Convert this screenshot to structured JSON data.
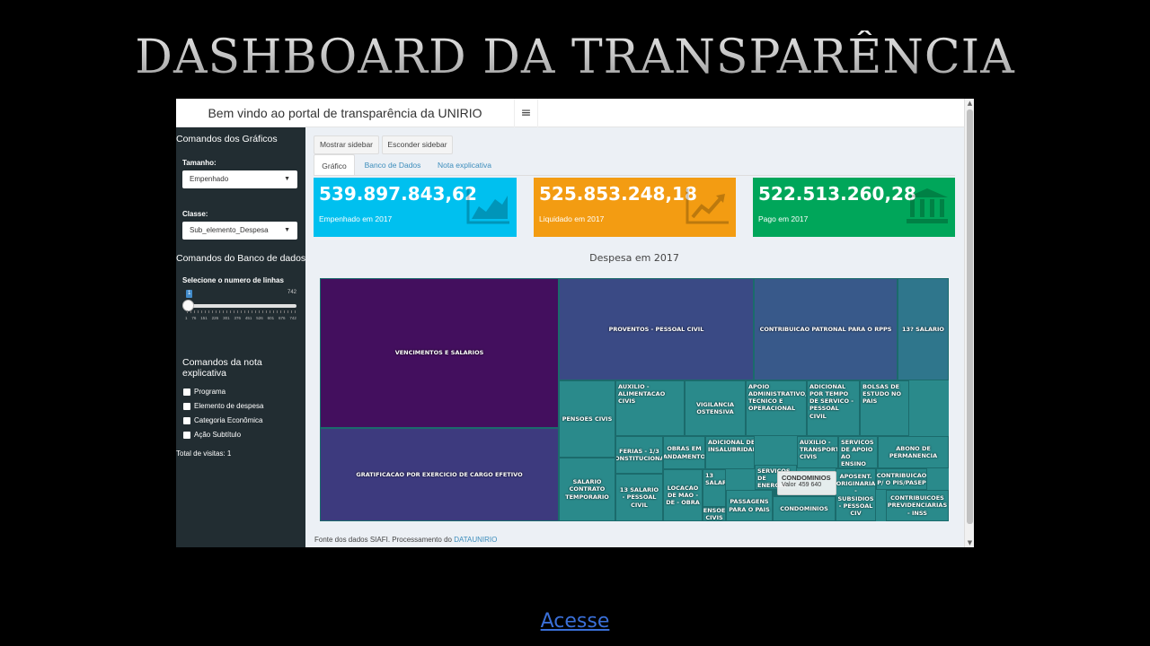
{
  "slide": {
    "title": "Dashboard da Transparência",
    "link_label": "Acesse"
  },
  "header": {
    "brand": "Bem vindo ao portal de transparência da UNIRIO",
    "menu_icon": "≡"
  },
  "sidebar": {
    "section_graphs": "Comandos dos Gráficos",
    "size_label": "Tamanho:",
    "size_value": "Empenhado",
    "class_label": "Classe:",
    "class_value": "Sub_elemento_Despesa",
    "section_db": "Comandos do Banco de dados",
    "rows_label": "Selecione o numero de linhas",
    "slider": {
      "min": "1",
      "max": "742",
      "value": "1",
      "grid": [
        "1",
        "76",
        "151",
        "226",
        "301",
        "376",
        "451",
        "526",
        "601",
        "676",
        "742"
      ]
    },
    "section_note_1": "Comandos da nota",
    "section_note_2": "explicativa",
    "checks": [
      "Programa",
      "Elemento de despesa",
      "Categoria Econômica",
      "Ação Subtítulo"
    ],
    "visits": "Total de visitas: 1"
  },
  "toolbar": {
    "show_sidebar": "Mostrar sidebar",
    "hide_sidebar": "Esconder sidebar"
  },
  "tabs": [
    "Gráfico",
    "Banco de Dados",
    "Nota explicativa"
  ],
  "value_boxes": [
    {
      "value": "539.897.843,62",
      "label": "Empenhado em 2017",
      "color": "#00c0ef",
      "icon": "area-chart-icon"
    },
    {
      "value": "525.853.248,18",
      "label": "Liquidado em 2017",
      "color": "#f39c12",
      "icon": "line-chart-icon"
    },
    {
      "value": "522.513.260,28",
      "label": "Pago em 2017",
      "color": "#00a65a",
      "icon": "bank-icon"
    }
  ],
  "chart_data": {
    "type": "treemap",
    "title": "Despesa em 2017",
    "cells": [
      {
        "name": "VENCIMENTOS E SALARIOS",
        "color": "#430f5e"
      },
      {
        "name": "GRATIFICACAO POR EXERCICIO DE CARGO EFETIVO",
        "color": "#3d3a7e"
      },
      {
        "name": "PROVENTOS - PESSOAL CIVIL",
        "color": "#3a4a85"
      },
      {
        "name": "CONTRIBUICAO PATRONAL PARA O RPPS",
        "color": "#38598a"
      },
      {
        "name": "13? SALARIO",
        "color": "#2f768c"
      },
      {
        "name": "PENSOES CIVIS",
        "color": "#2a8a8b"
      },
      {
        "name": "AUXILIO - ALIMENTACAO CIVIS",
        "color": "#2a8a8b"
      },
      {
        "name": "VIGILANCIA OSTENSIVA",
        "color": "#2a8a8b"
      },
      {
        "name": "APOIO ADMINISTRATIVO, TECNICO E OPERACIONAL",
        "color": "#2a8a8b"
      },
      {
        "name": "ADICIONAL POR TEMPO DE SERVICO - PESSOAL CIVIL",
        "color": "#2a8a8b"
      },
      {
        "name": "BOLSAS DE ESTUDO NO PAIS",
        "color": "#2a8a8b"
      },
      {
        "name": "FERIAS - 1/3 CONSTITUCIONAL",
        "color": "#2a8a8b"
      },
      {
        "name": "OBRAS EM ANDAMENTO",
        "color": "#2a8a8b"
      },
      {
        "name": "ADICIONAL DE INSALUBRIDADE",
        "color": "#2a8a8b"
      },
      {
        "name": "AUXILIO - TRANSPORTE CIVIS",
        "color": "#2a8a8b"
      },
      {
        "name": "SERVICOS DE APOIO AO ENSINO",
        "color": "#2a8a8b"
      },
      {
        "name": "ABONO DE PERMANENCIA",
        "color": "#2a8a8b"
      },
      {
        "name": "SALARIO CONTRATO TEMPORARIO",
        "color": "#2a8a8b"
      },
      {
        "name": "13 SALARIO - PESSOAL CIVIL",
        "color": "#2a8a8b"
      },
      {
        "name": "LOCACAO DE MAO - DE - OBRA",
        "color": "#2a8a8b"
      },
      {
        "name": "13 SALARIO",
        "color": "#2a8a8b"
      },
      {
        "name": "PENSOES CIVIS",
        "color": "#2a8a8b"
      },
      {
        "name": "PASSAGENS PARA O PAIS",
        "color": "#2a8a8b"
      },
      {
        "name": "SERVICOS DE ENERGIA ELETRICA",
        "color": "#2a8a8b"
      },
      {
        "name": "CONDOMINIOS",
        "color": "#2a8a8b"
      },
      {
        "name": "APOSENT. ORIGINARIA - SUBSIDIOS - PESSOAL CIV",
        "color": "#2a8a8b"
      },
      {
        "name": "CONTRIBUICAO P/ O PIS/PASEP",
        "color": "#2a8a8b"
      },
      {
        "name": "CONTRIBUICOES PREVIDENCIARIAS - INSS",
        "color": "#2a8a8b"
      }
    ],
    "tooltip": {
      "name": "CONDOMINIOS",
      "label": "Valor",
      "value": "459 640"
    }
  },
  "footer": {
    "text": "Fonte dos dados SIAFI. Processamento do ",
    "link": "DATAUNIRIO"
  }
}
